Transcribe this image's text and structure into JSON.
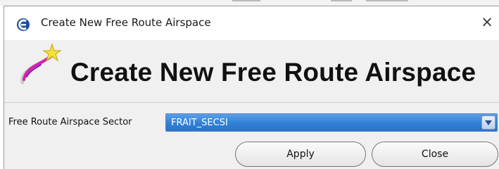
{
  "window": {
    "title": "Create New Free Route Airspace",
    "close_glyph": "×",
    "app_icon": "app-logo-icon"
  },
  "header": {
    "heading": "Create New Free Route Airspace",
    "icon": "magic-wand-star-icon"
  },
  "form": {
    "sector_label": "Free Route Airspace Sector",
    "sector_value": "FRAIT_SECSI"
  },
  "buttons": {
    "apply_label": "Apply",
    "close_label": "Close"
  },
  "colors": {
    "combo_selected": "#2f7fd6",
    "window_bg": "#f0f0f0",
    "titlebar_bg": "#ffffff"
  }
}
